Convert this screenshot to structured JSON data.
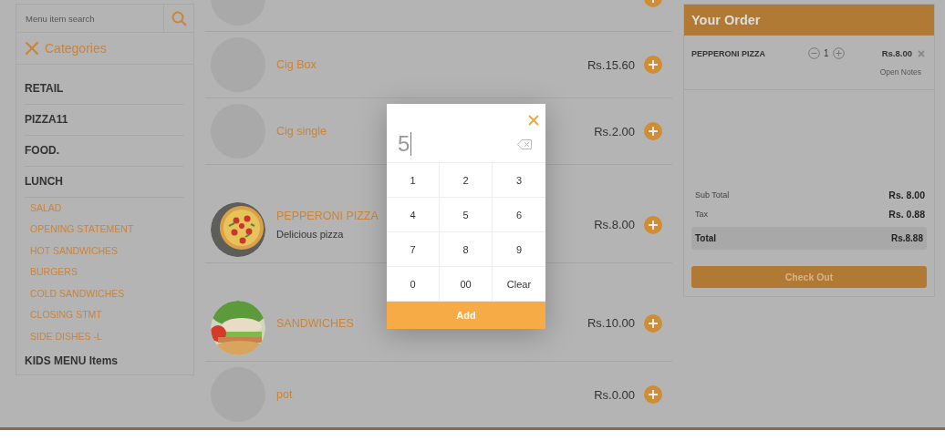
{
  "search": {
    "placeholder": "Menu item search"
  },
  "categories": {
    "title": "Categories",
    "items": [
      {
        "kind": "main",
        "label": "RETAIL"
      },
      {
        "kind": "main",
        "label": "PIZZA11"
      },
      {
        "kind": "main",
        "label": "FOOD."
      },
      {
        "kind": "main",
        "label": "LUNCH"
      },
      {
        "kind": "sub",
        "label": "SALAD"
      },
      {
        "kind": "sub",
        "label": "OPENING STATEMENT"
      },
      {
        "kind": "sub",
        "label": "HOT SANDWICHES"
      },
      {
        "kind": "sub",
        "label": "BURGERS"
      },
      {
        "kind": "sub",
        "label": "COLD SANDWICHES"
      },
      {
        "kind": "sub",
        "label": "CLOSING STMT"
      },
      {
        "kind": "sub",
        "label": "SIDE DISHES -L"
      },
      {
        "kind": "main",
        "label": "KIDS MENU Items"
      }
    ]
  },
  "menu_items": [
    {
      "kind": "plain"
    },
    {
      "kind": "plain",
      "name": "Cig Box",
      "price": "Rs.15.60"
    },
    {
      "kind": "plain",
      "name": "Cig single",
      "price": "Rs.2.00"
    },
    {
      "kind": "pizza",
      "name": "PEPPERONI PIZZA",
      "description": "Delicious pizza",
      "price": "Rs.8.00"
    },
    {
      "kind": "sandwich",
      "name": "SANDWICHES",
      "price": "Rs.10.00"
    },
    {
      "kind": "plain",
      "name": "pot",
      "price": "Rs.0.00"
    }
  ],
  "order": {
    "title": "Your Order",
    "items": [
      {
        "name": "PEPPERONI PIZZA",
        "quantity": "1",
        "price": "Rs.8.00",
        "notes_link": "Open Notes"
      }
    ],
    "subtotal_label": "Sub Total",
    "subtotal": "Rs. 8.00",
    "tax_label": "Tax",
    "tax": "Rs. 0.88",
    "total_label": "Total",
    "total": "Rs.8.88",
    "checkout": "Check Out"
  },
  "keypad": {
    "value": "5",
    "keys": [
      "1",
      "2",
      "3",
      "4",
      "5",
      "6",
      "7",
      "8",
      "9",
      "0",
      "00",
      "Clear"
    ],
    "add": "Add"
  }
}
